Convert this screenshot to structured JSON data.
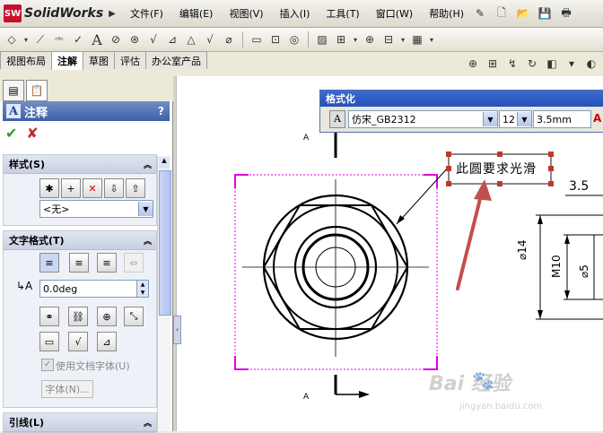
{
  "app": {
    "brand_badge": "SW",
    "brand_name": "SolidWorks"
  },
  "menu": [
    "文件(F)",
    "编辑(E)",
    "视图(V)",
    "插入(I)",
    "工具(T)",
    "窗口(W)",
    "帮助(H)"
  ],
  "tabs": [
    {
      "label": "视图布局",
      "active": false
    },
    {
      "label": "注解",
      "active": true
    },
    {
      "label": "草图",
      "active": false
    },
    {
      "label": "评估",
      "active": false
    },
    {
      "label": "办公室产品",
      "active": false
    }
  ],
  "panel": {
    "title": "注释",
    "help": "?",
    "ok_icon": "check-icon",
    "cancel_icon": "x-icon",
    "style_group": {
      "title": "样式(S)",
      "select_value": "<无>"
    },
    "text_format_group": {
      "title": "文字格式(T)",
      "angle_value": "0.0deg",
      "use_doc_font_label": "使用文档字体(U)",
      "use_doc_font_checked": true,
      "font_button": "字体(N)..."
    },
    "leader_group": {
      "title": "引线(L)"
    }
  },
  "format_dialog": {
    "title": "格式化",
    "font": "仿宋_GB2312",
    "size": "12",
    "height": "3.5mm"
  },
  "drawing": {
    "note_text": "此圆要求光滑",
    "section_label_top": "A",
    "section_label_bottom": "A",
    "dim_35": "3.5",
    "dim_d14": "⌀14",
    "dim_m10": "M10",
    "dim_d5": "⌀5",
    "colors": {
      "selection": "#e000e0",
      "handle": "#c0392b",
      "arrow": "#c0504d"
    }
  },
  "watermark": {
    "brand": "Bai  经验",
    "url": "jingyan.baidu.com"
  }
}
